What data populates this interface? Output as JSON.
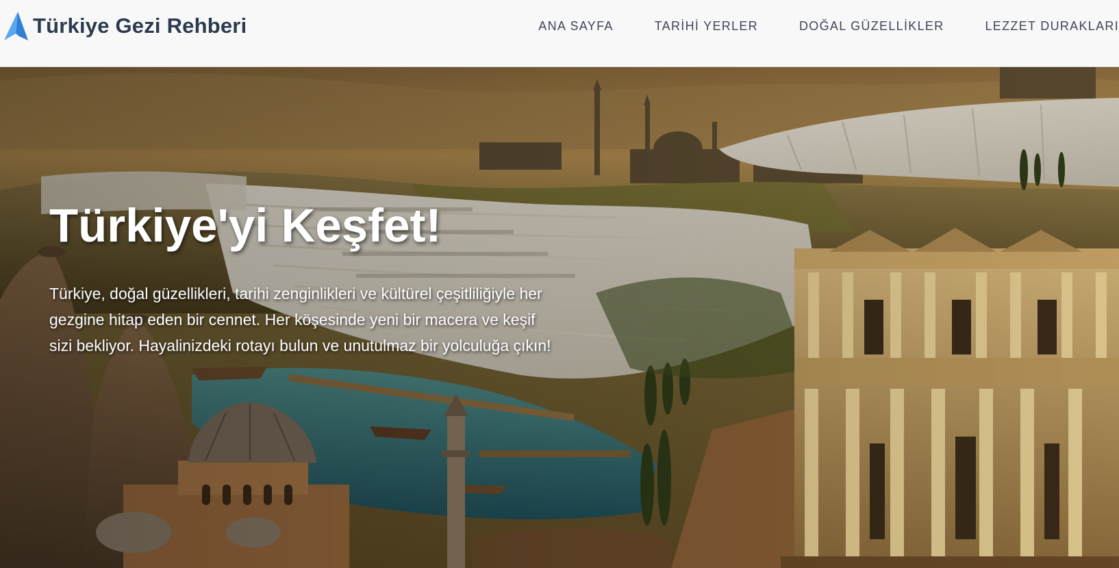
{
  "header": {
    "brand": "Türkiye Gezi Rehberi",
    "logo_icon": "paper-plane-logo",
    "nav": [
      {
        "label": "ANA SAYFA"
      },
      {
        "label": "TARİHİ YERLER"
      },
      {
        "label": "DOĞAL GÜZELLİKLER"
      },
      {
        "label": "LEZZET DURAKLARI"
      }
    ]
  },
  "hero": {
    "title": "Türkiye'yi Keşfet!",
    "description": "Türkiye, doğal güzellikleri, tarihi zenginlikleri ve kültürel çeşitliliğiyle her gezgine hitap eden bir cennet. Her köşesinde yeni bir macera ve keşif sizi bekliyor. Hayalinizdeki rotayı bulun ve unutulmaz bir yolculuğa çıkın!",
    "background_image": "turkey-landmarks-collage"
  },
  "colors": {
    "header_bg": "#f8f8f8",
    "brand_text": "#2b3a4f",
    "logo_blue": "#3f8ee0",
    "nav_text": "#3c4656",
    "hero_text": "#ffffff"
  }
}
